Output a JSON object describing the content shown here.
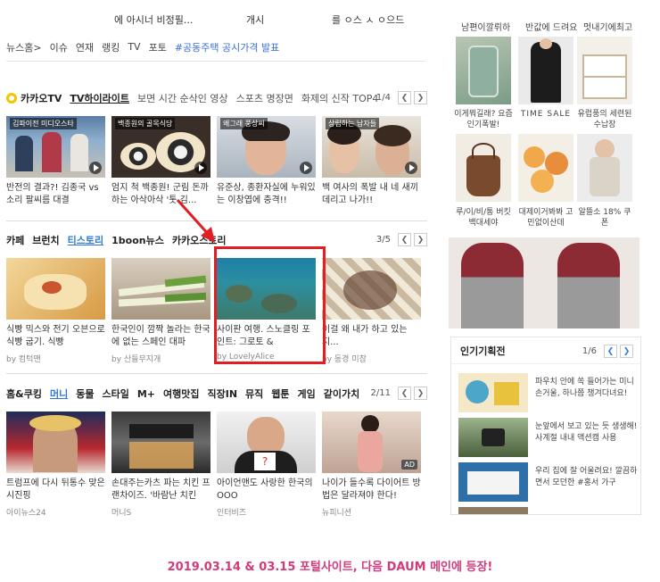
{
  "top_strip": {
    "left": "에 아시너 비정필...",
    "mid": "개시",
    "right": "를 ㅇ스 ㅅ ㅇ으드"
  },
  "newsnav": {
    "items": [
      "뉴스홈>",
      "이슈",
      "연재",
      "랭킹",
      "TV",
      "포토"
    ],
    "highlight": "#공동주택 공시가격 발표"
  },
  "kakaotv": {
    "logo": "카카오TV",
    "tabs": [
      "TV하이라이트",
      "보면 시간 순삭인 영상",
      "스포츠 명장면",
      "화제의 신작 TOP4"
    ],
    "page": "1/4",
    "cards": [
      {
        "tag": "김파이전 미디오스타",
        "title": "반전의 결과?! 김종국 vs 소리 팔씨름 대결"
      },
      {
        "tag": "백종원의 골목식당",
        "title": "엄지 척 백종원! 군림 돈까 하는 아삭아삭 '톳 김..."
      },
      {
        "tag": "왜그래 풍상씨",
        "title": "유준상, 종환자실에 누워있는 이창엽에 충격!!"
      },
      {
        "tag": "상립하는 남자들",
        "title": "백 여사의 폭발 내 네 새끼 데리고 나가!!"
      }
    ]
  },
  "cafe": {
    "tabs": [
      "카페",
      "브런치",
      "티스토리",
      "1boon뉴스",
      "카카오스토리"
    ],
    "active_tab": "티스토리",
    "page": "3/5",
    "cards": [
      {
        "title": "식빵 믹스와 전기 오븐으로 식빵 굽기. 식빵",
        "source": "by 컴턱맨"
      },
      {
        "title": "한국인이 깜짝 놀라는 한국에 없는 스페인 대파",
        "source": "by 산들무지개"
      },
      {
        "title": "사이판 여행. 스노클링 포인트: 그로토 &",
        "source": "by LovelyAlice"
      },
      {
        "title": "이걸 왜 내가 하고 있는지...",
        "source": "by 동경 미참"
      }
    ]
  },
  "cooking": {
    "tabs": [
      "홈&쿠킹",
      "머니",
      "동물",
      "스타일",
      "M+",
      "여행맛집",
      "직장IN",
      "뮤직",
      "웹툰",
      "게임",
      "같이가치"
    ],
    "active_tab": "머니",
    "page": "2/11",
    "cards": [
      {
        "title": "트럼프에 다시 뒤통수 맞은 시진핑",
        "source": "아이뉴스24"
      },
      {
        "title": "손대주는카츠 파는 치킨 프랜차이즈. '바람난 치킨",
        "source": "머니S"
      },
      {
        "title": "아이언맨도 사랑한 한국의 OOO",
        "source": "인터비즈"
      },
      {
        "title": "나이가 들수록 다이어트 방법은 달라져야 한다!",
        "source": "뉴피니션"
      }
    ]
  },
  "shopping": {
    "row1_labels": [
      "남편이깔뤼하",
      "반값에 드려요",
      "멋내기에최고"
    ],
    "row2_caps": [
      "이게뭐길래? 요즘인기폭발!",
      "TIME SALE",
      "유럽풍의 세련된 수납장"
    ],
    "row3_caps": [
      "루/이/비/통 버킷백대세야",
      "대제이거봐봐 고민없이산데",
      "알뜰소 18% 쿠폰"
    ]
  },
  "popular": {
    "title": "인기기획전",
    "page": "1/6",
    "items": [
      "파우치 안에 쏙 들어가는 미니 손거울, 하나쯤 챙겨다녀요!",
      "눈앞에서 보고 있는 듯 생생해! 사계절 내내 액션캠 사용",
      "우리 집에 잘 어울려요! 깔끔하면서 모던한 #홍서 가구",
      ""
    ]
  },
  "caption": "2019.03.14 & 03.15 포털사이트, 다음 DAUM 메인에 등장!",
  "colors": {
    "accent": "#2e7ad8",
    "highlight_box": "#e01e24",
    "caption": "#d43a7a"
  }
}
